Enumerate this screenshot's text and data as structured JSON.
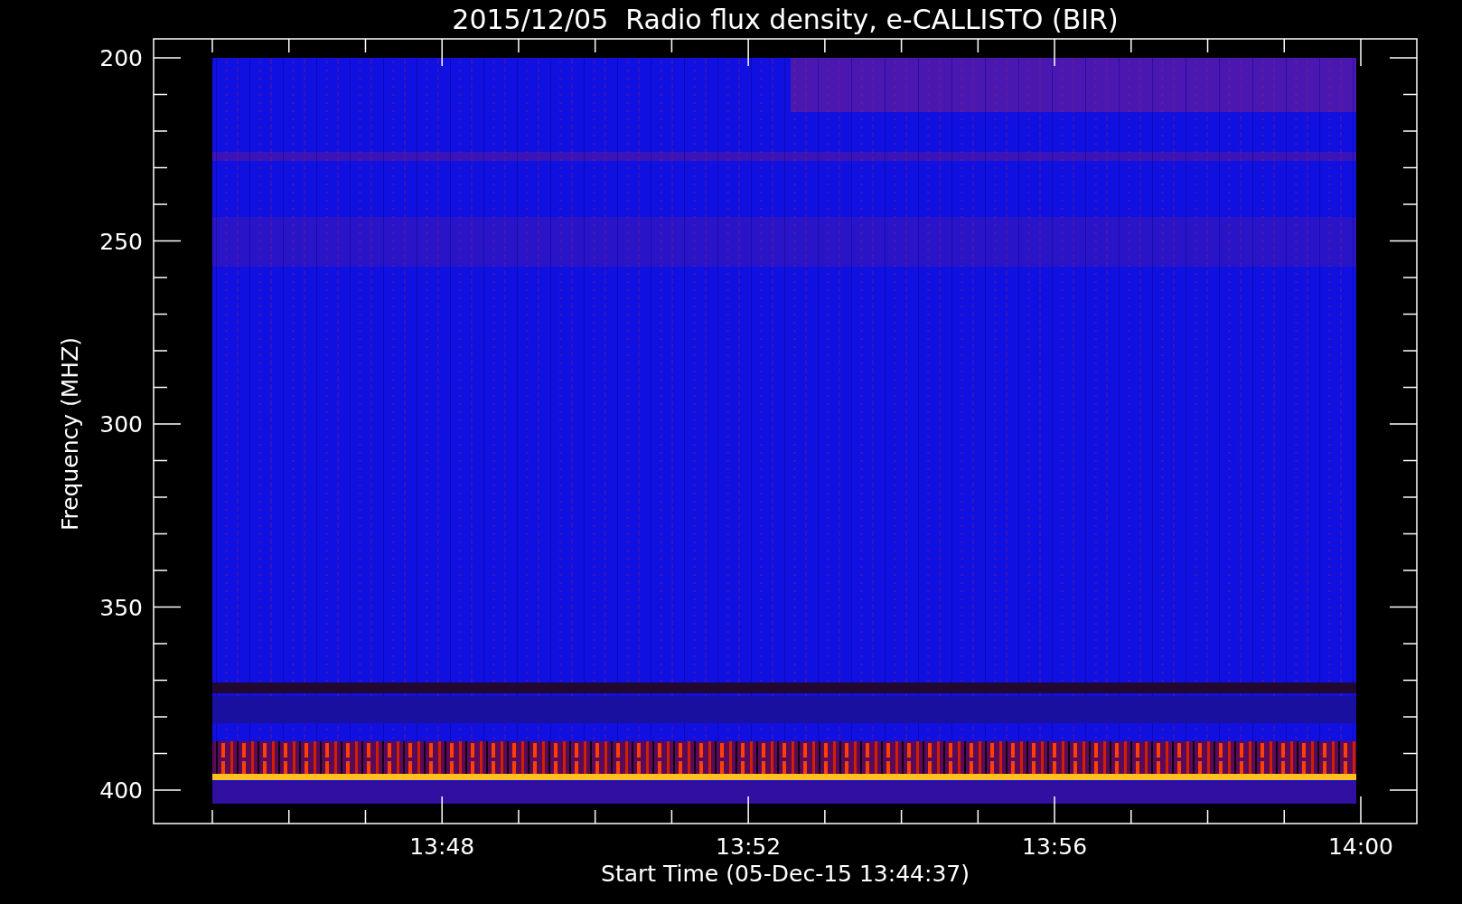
{
  "title": "2015/12/05  Radio flux density, e-CALLISTO (BIR)",
  "y_axis": {
    "label": "Frequency (MHZ)",
    "ticks": [
      "200",
      "250",
      "300",
      "350",
      "400"
    ]
  },
  "x_axis": {
    "label": "Start Time (05-Dec-15 13:44:37)",
    "ticks": [
      "13:48",
      "13:52",
      "13:56",
      "14:00"
    ]
  }
}
